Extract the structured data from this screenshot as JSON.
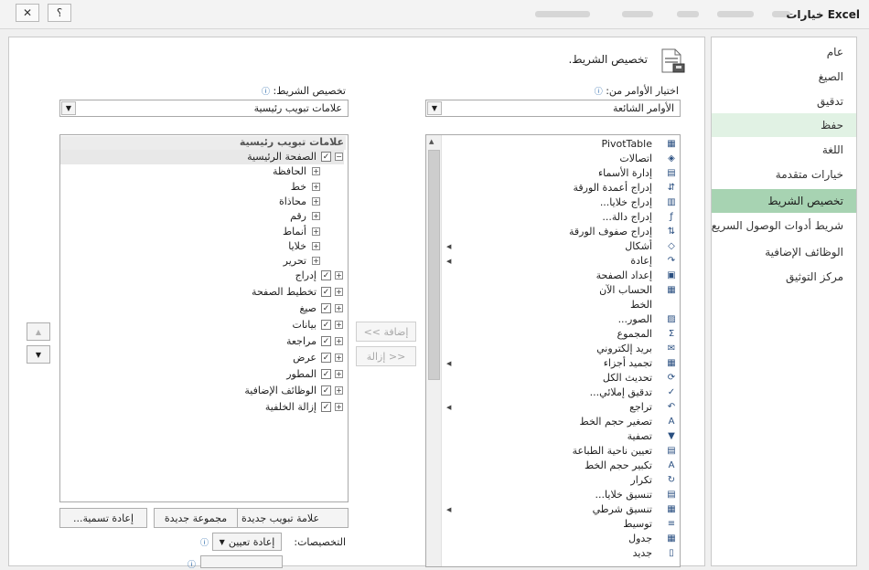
{
  "window": {
    "title": "خيارات Excel",
    "close_glyph": "✕",
    "help_glyph": "؟"
  },
  "categories": [
    {
      "label": "عام",
      "state": "normal"
    },
    {
      "label": "الصيغ",
      "state": "normal"
    },
    {
      "label": "تدقيق",
      "state": "normal"
    },
    {
      "label": "حفظ",
      "state": "hover"
    },
    {
      "label": "اللغة",
      "state": "normal"
    },
    {
      "label": "خيارات متقدمة",
      "state": "normal"
    },
    {
      "label": "تخصيص الشريط",
      "state": "selected"
    },
    {
      "label": "شريط أدوات الوصول السريع",
      "state": "normal"
    },
    {
      "label": "الوظائف الإضافية",
      "state": "normal"
    },
    {
      "label": "مركز التوثيق",
      "state": "normal"
    }
  ],
  "header": {
    "title": "تخصيص الشريط."
  },
  "choose_commands": {
    "label": "اختيار الأوامر من:",
    "value": "الأوامر الشائعة"
  },
  "customize_ribbon": {
    "label": "تخصيص الشريط:",
    "value": "علامات تبويب رئيسية"
  },
  "commands": [
    {
      "label": "PivotTable",
      "icon": "pivot-table-icon",
      "glyph": "▦",
      "sub": false
    },
    {
      "label": "اتصالات",
      "icon": "connections-icon",
      "glyph": "◈",
      "sub": false
    },
    {
      "label": "إدارة الأسماء",
      "icon": "name-manager-icon",
      "glyph": "▤",
      "sub": false
    },
    {
      "label": "إدراج أعمدة الورقة",
      "icon": "insert-columns-icon",
      "glyph": "⇵",
      "sub": false
    },
    {
      "label": "إدراج خلايا...",
      "icon": "insert-cells-icon",
      "glyph": "▥",
      "sub": false
    },
    {
      "label": "إدراج دالة...",
      "icon": "insert-function-icon",
      "glyph": "ƒ",
      "sub": false
    },
    {
      "label": "إدراج صفوف الورقة",
      "icon": "insert-rows-icon",
      "glyph": "⇅",
      "sub": false
    },
    {
      "label": "أشكال",
      "icon": "shapes-icon",
      "glyph": "◇",
      "sub": true
    },
    {
      "label": "إعادة",
      "icon": "redo-icon",
      "glyph": "↷",
      "sub": true
    },
    {
      "label": "إعداد الصفحة",
      "icon": "page-setup-icon",
      "glyph": "▣",
      "sub": false
    },
    {
      "label": "الحساب الآن",
      "icon": "calculate-now-icon",
      "glyph": "▦",
      "sub": false
    },
    {
      "label": "الخط",
      "icon": "font-icon",
      "glyph": "",
      "sub": false
    },
    {
      "label": "الصور...",
      "icon": "pictures-icon",
      "glyph": "▨",
      "sub": false
    },
    {
      "label": "المجموع",
      "icon": "autosum-icon",
      "glyph": "Σ",
      "sub": false
    },
    {
      "label": "بريد إلكتروني",
      "icon": "email-icon",
      "glyph": "✉",
      "sub": false
    },
    {
      "label": "تجميد أجزاء",
      "icon": "freeze-panes-icon",
      "glyph": "▦",
      "sub": true
    },
    {
      "label": "تحديث الكل",
      "icon": "refresh-all-icon",
      "glyph": "⟳",
      "sub": false
    },
    {
      "label": "تدقيق إملائي...",
      "icon": "spelling-icon",
      "glyph": "✓",
      "sub": false
    },
    {
      "label": "تراجع",
      "icon": "undo-icon",
      "glyph": "↶",
      "sub": true
    },
    {
      "label": "تصغير حجم الخط",
      "icon": "decrease-font-icon",
      "glyph": "A",
      "sub": false
    },
    {
      "label": "تصفية",
      "icon": "filter-icon",
      "glyph": "▼",
      "sub": false
    },
    {
      "label": "تعيين ناحية الطباعة",
      "icon": "print-area-icon",
      "glyph": "▤",
      "sub": false
    },
    {
      "label": "تكبير حجم الخط",
      "icon": "increase-font-icon",
      "glyph": "A",
      "sub": false
    },
    {
      "label": "تكرار",
      "icon": "repeat-icon",
      "glyph": "↻",
      "sub": false
    },
    {
      "label": "تنسيق خلايا...",
      "icon": "format-cells-icon",
      "glyph": "▤",
      "sub": false
    },
    {
      "label": "تنسيق شرطي",
      "icon": "conditional-formatting-icon",
      "glyph": "▦",
      "sub": true
    },
    {
      "label": "توسيط",
      "icon": "center-icon",
      "glyph": "≡",
      "sub": false
    },
    {
      "label": "جدول",
      "icon": "table-icon",
      "glyph": "▦",
      "sub": false
    },
    {
      "label": "جديد",
      "icon": "new-file-icon",
      "glyph": "▯",
      "sub": false
    }
  ],
  "tree": {
    "heading": "علامات تبويب رئيسية",
    "home_tab": "الصفحة الرئيسية",
    "home_groups": [
      "الحافظة",
      "خط",
      "محاذاة",
      "رقم",
      "أنماط",
      "خلايا",
      "تحرير"
    ],
    "tabs": [
      "إدراج",
      "تخطيط الصفحة",
      "صيغ",
      "بيانات",
      "مراجعة",
      "عرض",
      "المطور",
      "الوظائف الإضافية",
      "إزالة الخلفية"
    ]
  },
  "buttons": {
    "add": "إضافة >>",
    "remove": "<< إزالة",
    "new_tab": "علامة تبويب جديدة",
    "new_group": "مجموعة جديدة",
    "rename": "إعادة تسمية..."
  },
  "customizations": {
    "label": "التخصيصات:",
    "reset": "إعادة تعيين"
  },
  "glyphs": {
    "check": "✓",
    "plus": "+",
    "minus": "−",
    "arrow_down": "▼",
    "arrow_up": "▲",
    "info": "ⓘ"
  }
}
